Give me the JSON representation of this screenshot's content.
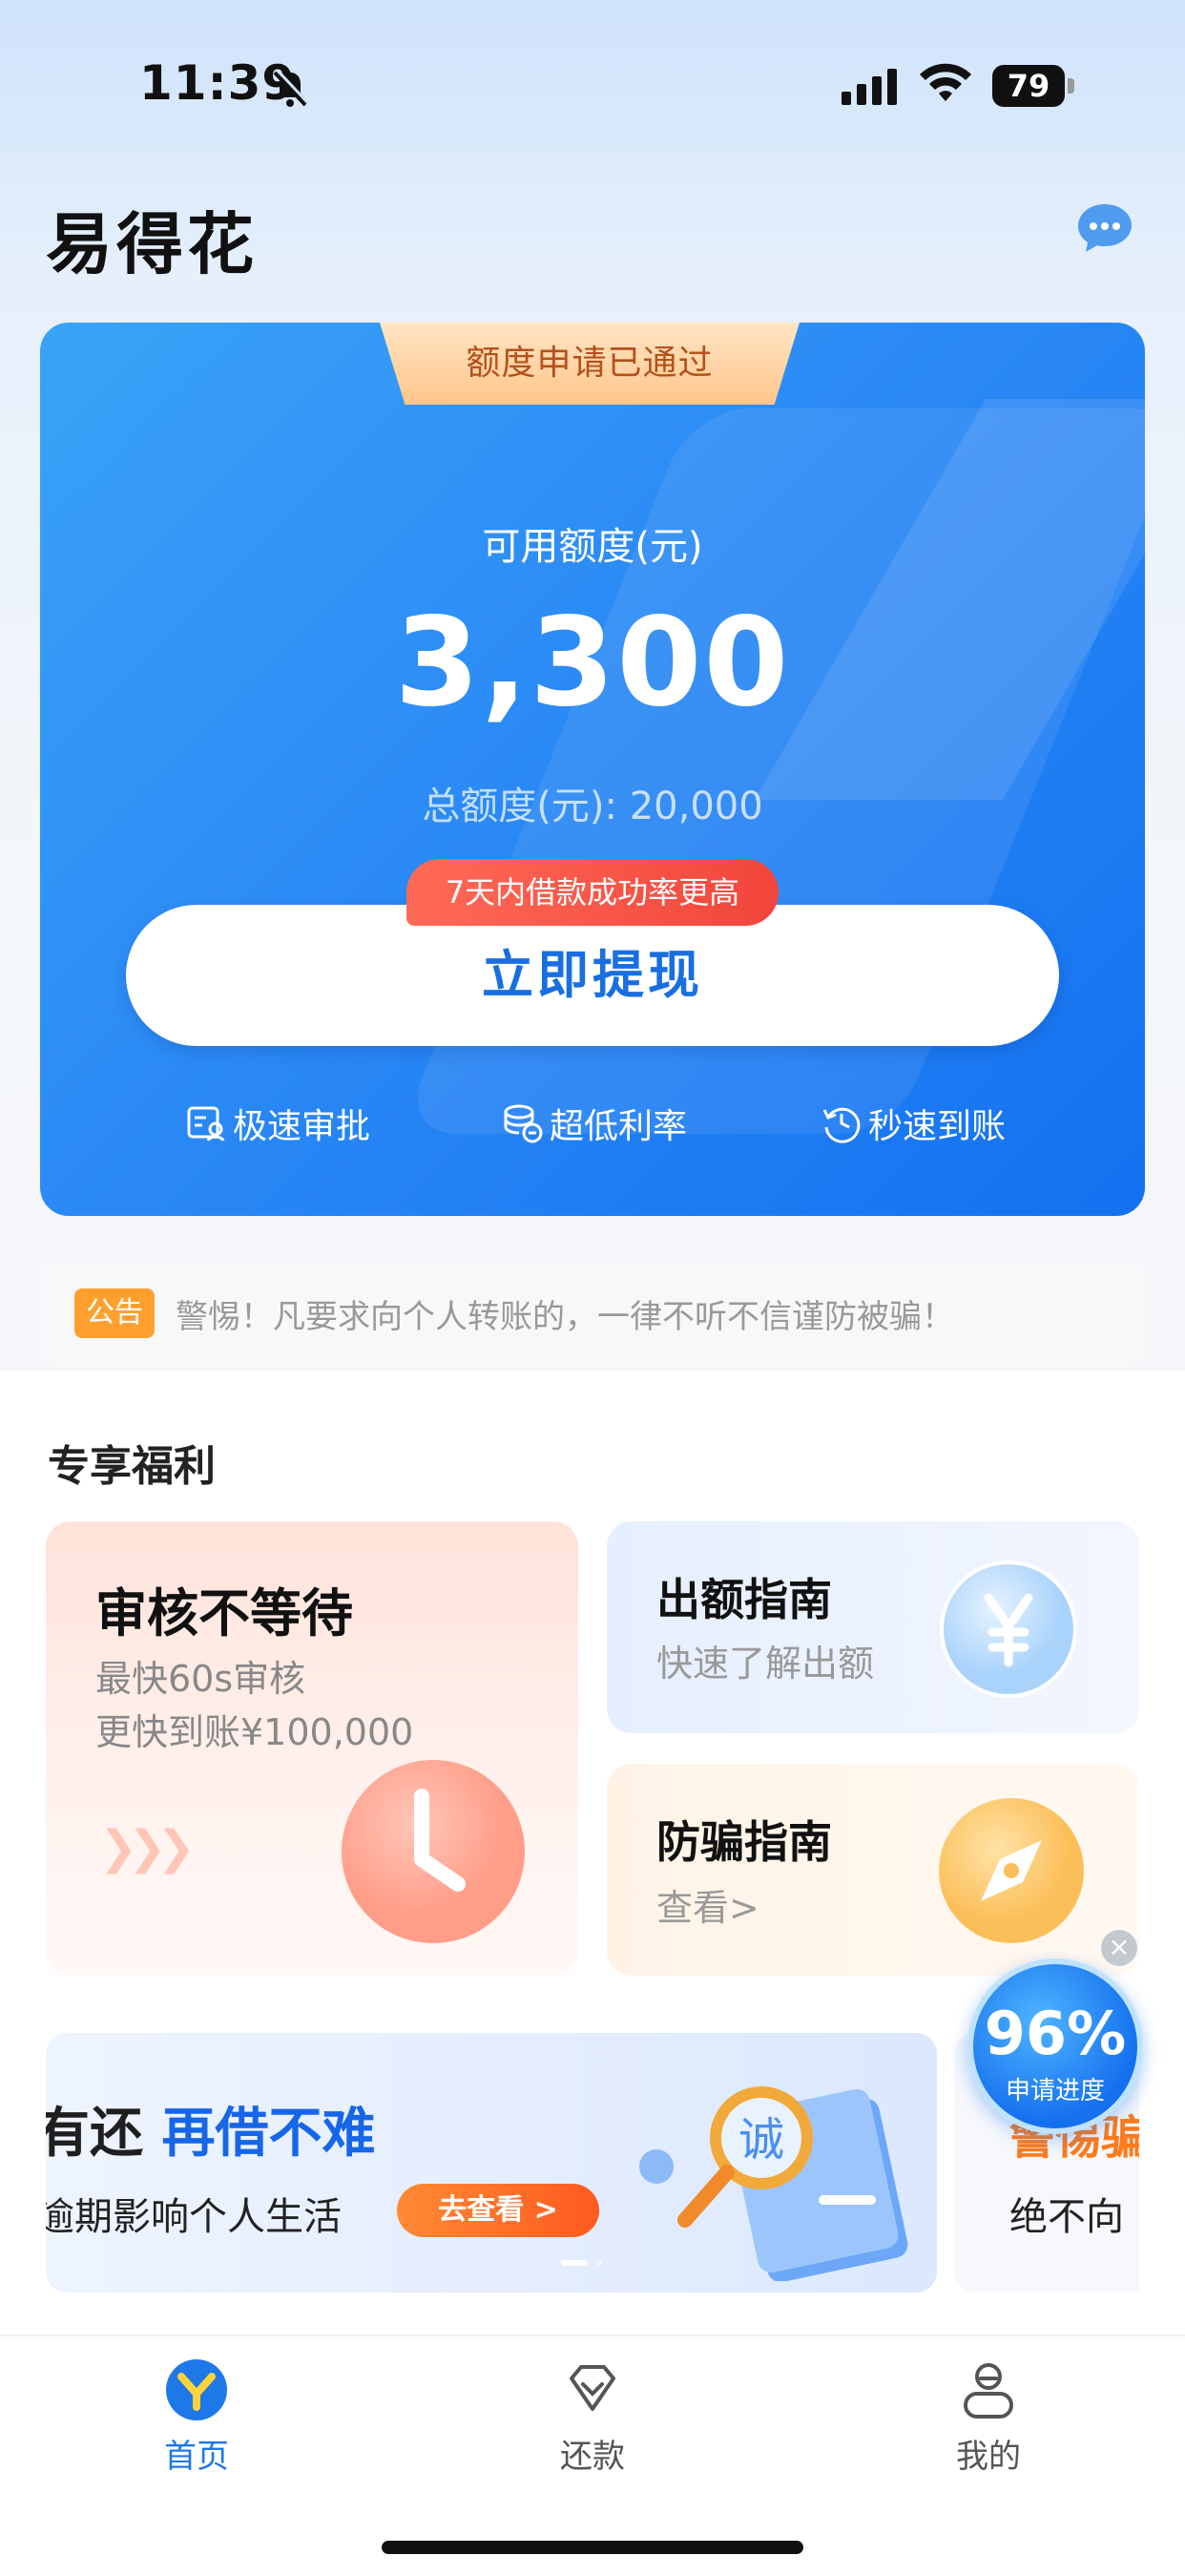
{
  "status_bar": {
    "time": "11:39",
    "battery": "79"
  },
  "header": {
    "title": "易得花"
  },
  "hero": {
    "badge": "额度申请已通过",
    "available_label": "可用额度(元)",
    "available_amount": "3,300",
    "total_label": "总额度(元): 20,000",
    "promo_tag": "7天内借款成功率更高",
    "withdraw_button": "立即提现",
    "features": [
      "极速审批",
      "超低利率",
      "秒速到账"
    ]
  },
  "notice": {
    "badge": "公告",
    "text": "警惕！凡要求向个人转账的，一律不听不信谨防被骗！"
  },
  "benefits": {
    "title": "专享福利",
    "audit": {
      "title": "审核不等待",
      "line1": "最快60s审核",
      "line2": "更快到账¥100,000"
    },
    "guide": {
      "title": "出额指南",
      "subtitle": "快速了解出额"
    },
    "fraud": {
      "title": "防骗指南",
      "subtitle": "查看>"
    }
  },
  "banner": {
    "line1_prefix": "有还 ",
    "line1_highlight": "再借不难",
    "line2": "逾期影响个人生活",
    "button": "去查看 >",
    "art_text": "诚",
    "next_title": "警惕骗",
    "next_subtitle": "绝不向"
  },
  "float_widget": {
    "percent": "96%",
    "label": "申请进度",
    "close": "×"
  },
  "tabbar": {
    "items": [
      {
        "label": "首页",
        "active": true
      },
      {
        "label": "还款",
        "active": false
      },
      {
        "label": "我的",
        "active": false
      }
    ]
  },
  "colors": {
    "brand_blue": "#1a6fe0",
    "active_tab": "#1e78e8",
    "inactive_tab": "#555555",
    "notice_badge": "#ffa02e"
  }
}
